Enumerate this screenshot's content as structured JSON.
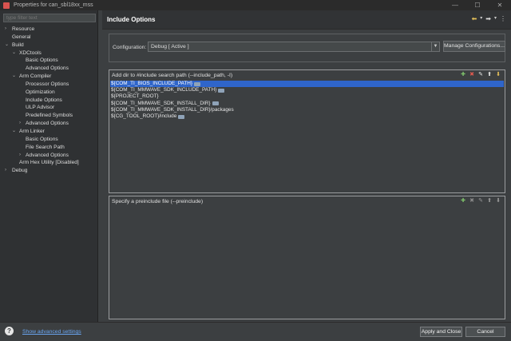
{
  "window": {
    "title": "Properties for can_sbl18xx_mss"
  },
  "sidebar": {
    "filter_placeholder": "type filter text",
    "items": [
      {
        "label": "Resource",
        "arrow": "›"
      },
      {
        "label": "General",
        "arrow": ""
      },
      {
        "label": "Build",
        "arrow": "⌄"
      },
      {
        "label": "XDCtools",
        "arrow": "⌄"
      },
      {
        "label": "Basic Options",
        "arrow": ""
      },
      {
        "label": "Advanced Options",
        "arrow": ""
      },
      {
        "label": "Arm Compiler",
        "arrow": "⌄"
      },
      {
        "label": "Processor Options",
        "arrow": ""
      },
      {
        "label": "Optimization",
        "arrow": ""
      },
      {
        "label": "Include Options",
        "arrow": ""
      },
      {
        "label": "ULP Advisor",
        "arrow": ""
      },
      {
        "label": "Predefined Symbols",
        "arrow": ""
      },
      {
        "label": "Advanced Options",
        "arrow": "›"
      },
      {
        "label": "Arm Linker",
        "arrow": "⌄"
      },
      {
        "label": "Basic Options",
        "arrow": ""
      },
      {
        "label": "File Search Path",
        "arrow": ""
      },
      {
        "label": "Advanced Options",
        "arrow": "›"
      },
      {
        "label": "Arm Hex Utility  [Disabled]",
        "arrow": ""
      },
      {
        "label": "Debug",
        "arrow": "›"
      }
    ]
  },
  "main": {
    "title": "Include Options",
    "configuration": {
      "label": "Configuration:",
      "value": "Debug  [ Active ]",
      "manage_label": "Manage Configurations..."
    },
    "include_path": {
      "title": "Add dir to #include search path (--include_path, -I)",
      "items": [
        "${COM_TI_BIOS_INCLUDE_PATH}",
        "${COM_TI_MMWAVE_SDK_INCLUDE_PATH}",
        "${PROJECT_ROOT}",
        "${COM_TI_MMWAVE_SDK_INSTALL_DIR}",
        "${COM_TI_MMWAVE_SDK_INSTALL_DIR}/packages",
        "${CG_TOOL_ROOT}/include"
      ]
    },
    "preinclude": {
      "title": "Specify a preinclude file (--preinclude)",
      "items": []
    }
  },
  "footer": {
    "advanced_link": "Show advanced settings",
    "apply_close": "Apply and Close",
    "cancel": "Cancel"
  },
  "colors": {
    "selection": "#2f65ca",
    "link": "#6aa6f2",
    "background": "#3c3f41"
  }
}
